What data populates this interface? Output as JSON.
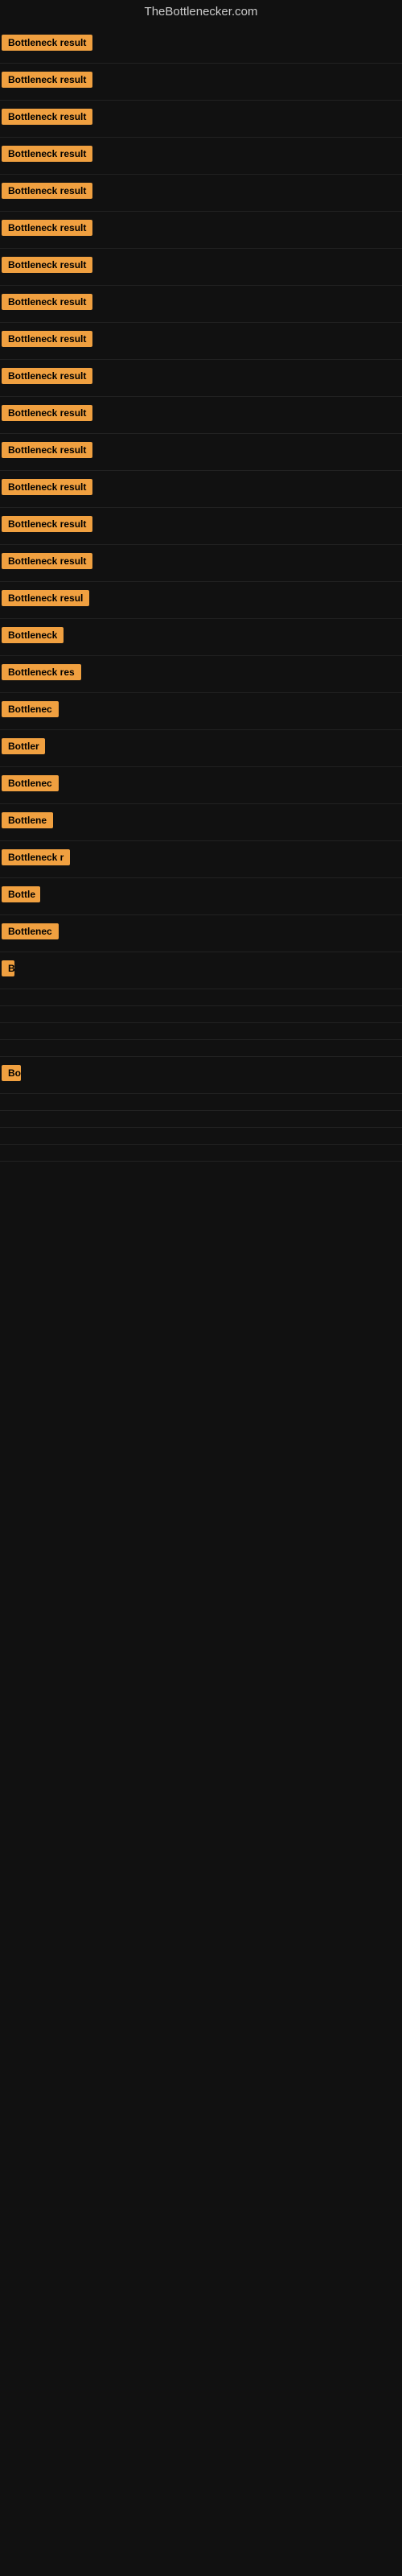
{
  "site": {
    "title": "TheBottlenecker.com"
  },
  "rows": [
    {
      "label": "Bottleneck result",
      "width": 130
    },
    {
      "label": "Bottleneck result",
      "width": 130
    },
    {
      "label": "Bottleneck result",
      "width": 130
    },
    {
      "label": "Bottleneck result",
      "width": 130
    },
    {
      "label": "Bottleneck result",
      "width": 130
    },
    {
      "label": "Bottleneck result",
      "width": 130
    },
    {
      "label": "Bottleneck result",
      "width": 130
    },
    {
      "label": "Bottleneck result",
      "width": 130
    },
    {
      "label": "Bottleneck result",
      "width": 130
    },
    {
      "label": "Bottleneck result",
      "width": 130
    },
    {
      "label": "Bottleneck result",
      "width": 130
    },
    {
      "label": "Bottleneck result",
      "width": 130
    },
    {
      "label": "Bottleneck result",
      "width": 130
    },
    {
      "label": "Bottleneck result",
      "width": 130
    },
    {
      "label": "Bottleneck result",
      "width": 130
    },
    {
      "label": "Bottleneck resul",
      "width": 116
    },
    {
      "label": "Bottleneck",
      "width": 78
    },
    {
      "label": "Bottleneck res",
      "width": 100
    },
    {
      "label": "Bottlenec",
      "width": 72
    },
    {
      "label": "Bottler",
      "width": 54
    },
    {
      "label": "Bottlenec",
      "width": 72
    },
    {
      "label": "Bottlene",
      "width": 64
    },
    {
      "label": "Bottleneck r",
      "width": 88
    },
    {
      "label": "Bottle",
      "width": 48
    },
    {
      "label": "Bottlenec",
      "width": 72
    },
    {
      "label": "B",
      "width": 16
    },
    {
      "label": "",
      "width": 4
    },
    {
      "label": "",
      "width": 0
    },
    {
      "label": "",
      "width": 0
    },
    {
      "label": "",
      "width": 0
    },
    {
      "label": "Bo",
      "width": 24
    },
    {
      "label": "",
      "width": 0
    },
    {
      "label": "",
      "width": 0
    },
    {
      "label": "",
      "width": 0
    },
    {
      "label": "",
      "width": 0
    }
  ],
  "colors": {
    "bar_bg": "#f0a040",
    "bar_text": "#000000",
    "background": "#111111",
    "title": "#cccccc"
  }
}
